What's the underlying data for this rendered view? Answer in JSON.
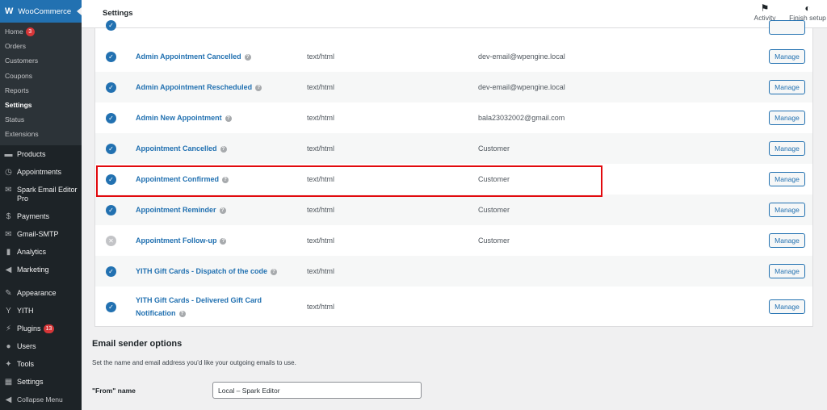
{
  "sidebar": {
    "brand": "WooCommerce",
    "submenu": [
      {
        "label": "Home",
        "badge": "3"
      },
      {
        "label": "Orders"
      },
      {
        "label": "Customers"
      },
      {
        "label": "Coupons"
      },
      {
        "label": "Reports"
      },
      {
        "label": "Settings",
        "current": true
      },
      {
        "label": "Status"
      },
      {
        "label": "Extensions"
      }
    ],
    "menu": [
      {
        "label": "Products",
        "icon": "archive-icon"
      },
      {
        "label": "Appointments",
        "icon": "clock-icon"
      },
      {
        "label": "Spark Email Editor Pro",
        "icon": "email-editor-icon"
      },
      {
        "label": "Payments",
        "icon": "dollar-icon"
      },
      {
        "label": "Gmail-SMTP",
        "icon": "mail-icon"
      },
      {
        "label": "Analytics",
        "icon": "bar-chart-icon"
      },
      {
        "label": "Marketing",
        "icon": "megaphone-icon"
      },
      {
        "label": "Appearance",
        "icon": "paintbrush-icon"
      },
      {
        "label": "YITH",
        "icon": "yith-icon"
      },
      {
        "label": "Plugins",
        "icon": "plugin-icon",
        "badge": "13"
      },
      {
        "label": "Users",
        "icon": "users-icon"
      },
      {
        "label": "Tools",
        "icon": "wrench-icon"
      },
      {
        "label": "Settings",
        "icon": "settings-icon"
      },
      {
        "label": "Collapse Menu",
        "icon": "collapse-icon"
      }
    ]
  },
  "topbar": {
    "title": "Settings",
    "activity_label": "Activity",
    "finish_label": "Finish setup"
  },
  "emails": [
    {
      "name": "Admin Appointment Cancelled",
      "type": "text/html",
      "recipient": "dev-email@wpengine.local",
      "enabled": true,
      "manage": "Manage"
    },
    {
      "name": "Admin Appointment Rescheduled",
      "type": "text/html",
      "recipient": "dev-email@wpengine.local",
      "enabled": true,
      "manage": "Manage"
    },
    {
      "name": "Admin New Appointment",
      "type": "text/html",
      "recipient": "bala23032002@gmail.com",
      "enabled": true,
      "manage": "Manage"
    },
    {
      "name": "Appointment Cancelled",
      "type": "text/html",
      "recipient": "Customer",
      "enabled": true,
      "manage": "Manage"
    },
    {
      "name": "Appointment Confirmed",
      "type": "text/html",
      "recipient": "Customer",
      "enabled": true,
      "manage": "Manage"
    },
    {
      "name": "Appointment Reminder",
      "type": "text/html",
      "recipient": "Customer",
      "enabled": true,
      "manage": "Manage"
    },
    {
      "name": "Appointment Follow-up",
      "type": "text/html",
      "recipient": "Customer",
      "enabled": false,
      "manage": "Manage"
    },
    {
      "name": "YITH Gift Cards - Dispatch of the code",
      "type": "text/html",
      "recipient": "",
      "enabled": true,
      "manage": "Manage"
    },
    {
      "name": "YITH Gift Cards - Delivered Gift Card Notification",
      "type": "text/html",
      "recipient": "",
      "enabled": true,
      "manage": "Manage"
    }
  ],
  "sender": {
    "heading": "Email sender options",
    "description": "Set the name and email address you'd like your outgoing emails to use.",
    "from_label": "\"From\" name",
    "from_value": "Local – Spark Editor"
  },
  "colors": {
    "accent": "#2271b1",
    "highlight": "#e2090d",
    "sidebar_bg": "#1d2327"
  }
}
